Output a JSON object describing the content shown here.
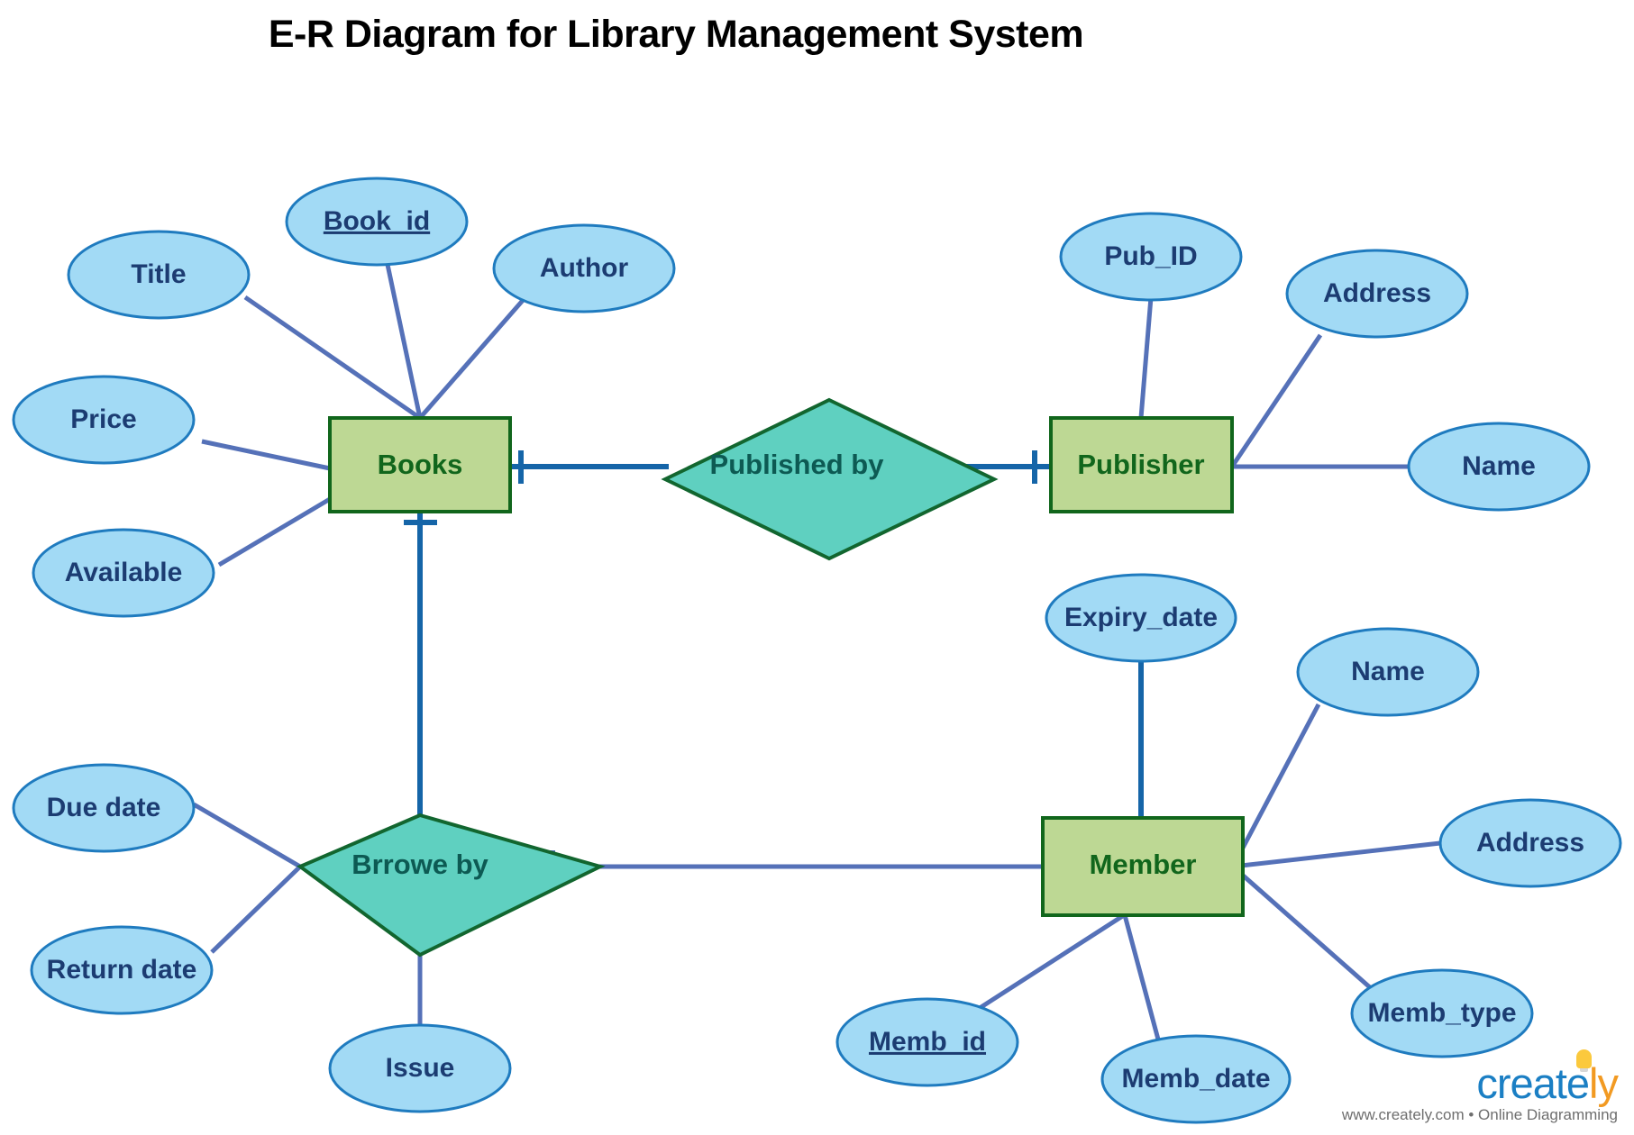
{
  "title": "E-R Diagram for Library Management System",
  "colors": {
    "attribute_fill": "#A2DAF5",
    "attribute_stroke": "#1F7BBF",
    "attribute_text": "#1C3C72",
    "entity_fill": "#BDD894",
    "entity_stroke": "#11661C",
    "entity_text": "#11661C",
    "relationship_fill": "#5FD0C0",
    "relationship_stroke": "#12662F",
    "relationship_text": "#0D5A53",
    "attribute_link": "#5571B8",
    "relationship_link": "#1565A8",
    "background": "#FFFFFF",
    "title_text": "#000000"
  },
  "entities": [
    {
      "id": "books",
      "label": "Books"
    },
    {
      "id": "publisher",
      "label": "Publisher"
    },
    {
      "id": "member",
      "label": "Member"
    }
  ],
  "relationships": [
    {
      "id": "published-by",
      "label": "Published by",
      "from": "Books",
      "to": "Publisher"
    },
    {
      "id": "brrowe-by",
      "label": "Brrowe by",
      "from": "Books",
      "to": "Member"
    }
  ],
  "attributes": {
    "books": [
      {
        "id": "title",
        "label": "Title",
        "primary_key": false
      },
      {
        "id": "book-id",
        "label": "Book_id",
        "primary_key": true
      },
      {
        "id": "author",
        "label": "Author",
        "primary_key": false
      },
      {
        "id": "price",
        "label": "Price",
        "primary_key": false
      },
      {
        "id": "available",
        "label": "Available",
        "primary_key": false
      }
    ],
    "publisher": [
      {
        "id": "pub-id",
        "label": "Pub_ID",
        "primary_key": false
      },
      {
        "id": "pub-address",
        "label": "Address",
        "primary_key": false
      },
      {
        "id": "pub-name",
        "label": "Name",
        "primary_key": false
      }
    ],
    "member": [
      {
        "id": "expiry-date",
        "label": "Expiry_date",
        "primary_key": false
      },
      {
        "id": "mem-name",
        "label": "Name",
        "primary_key": false
      },
      {
        "id": "mem-address",
        "label": "Address",
        "primary_key": false
      },
      {
        "id": "memb-type",
        "label": "Memb_type",
        "primary_key": false
      },
      {
        "id": "memb-id",
        "label": "Memb_id",
        "primary_key": true
      },
      {
        "id": "memb-date",
        "label": "Memb_date",
        "primary_key": false
      }
    ],
    "brrowe-by": [
      {
        "id": "due-date",
        "label": "Due date",
        "primary_key": false
      },
      {
        "id": "return-date",
        "label": "Return date",
        "primary_key": false
      },
      {
        "id": "issue",
        "label": "Issue",
        "primary_key": false
      }
    ]
  },
  "watermark": {
    "brand_part1": "create",
    "brand_part2": "ly",
    "tagline": "www.creately.com • Online Diagramming"
  }
}
